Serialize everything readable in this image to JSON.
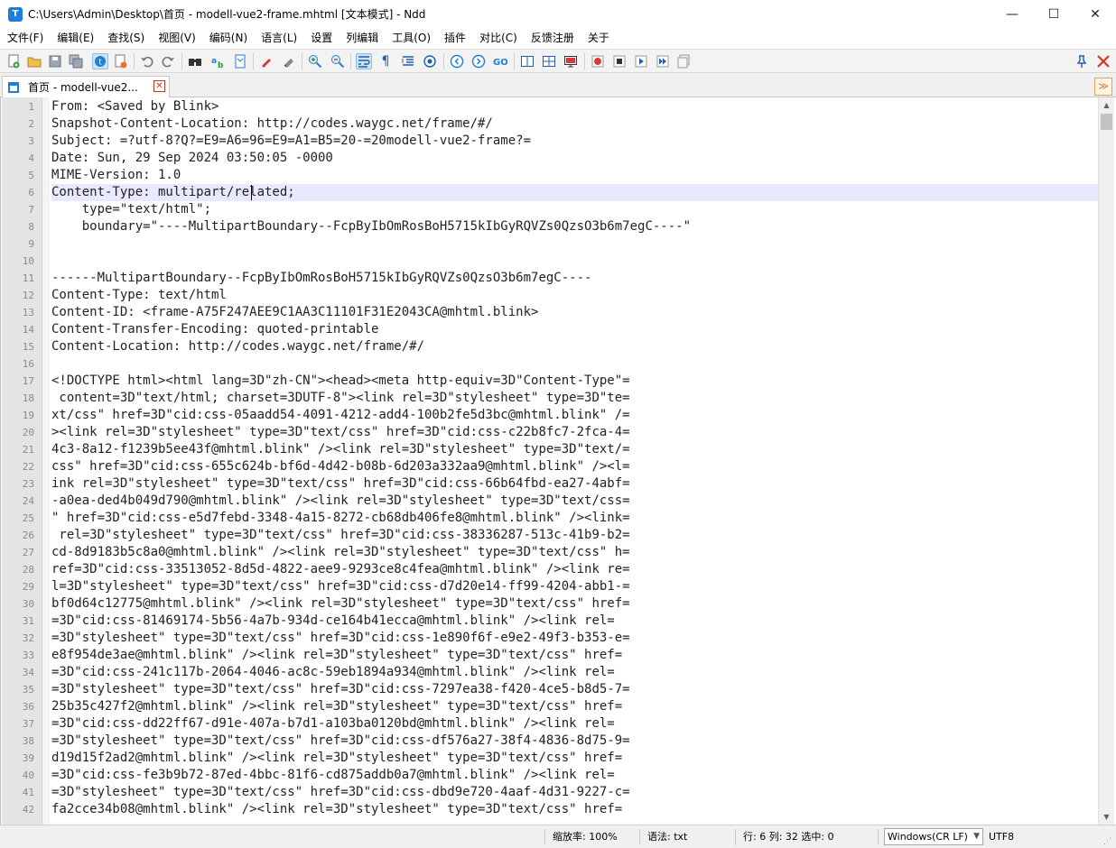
{
  "window": {
    "title": "C:\\Users\\Admin\\Desktop\\首页 - modell-vue2-frame.mhtml [文本模式] - Ndd",
    "app_icon_letter": "T",
    "minimize_glyph": "—",
    "maximize_glyph": "☐",
    "close_glyph": "✕"
  },
  "menu": [
    "文件(F)",
    "编辑(E)",
    "查找(S)",
    "视图(V)",
    "编码(N)",
    "语言(L)",
    "设置",
    "列编辑",
    "工具(O)",
    "插件",
    "对比(C)",
    "反馈注册",
    "关于"
  ],
  "toolbar": {
    "icons": [
      "new-file-icon",
      "open-file-icon",
      "save-icon",
      "save-all-icon",
      "text-mode-icon",
      "close-file-icon",
      "undo-icon",
      "redo-icon",
      "find-icon",
      "replace-icon",
      "bookmark-icon",
      "marker-icon",
      "eraser-icon",
      "zoom-in-icon",
      "zoom-out-icon",
      "word-wrap-icon",
      "show-symbols-icon",
      "indent-guide-icon",
      "target-icon",
      "prev-icon",
      "next-icon",
      "goto-icon",
      "split-horizontal-icon",
      "split-vertical-icon",
      "monitor-icon",
      "record-macro-icon",
      "stop-macro-icon",
      "play-macro-icon",
      "run-macro-multiple-icon",
      "save-macro-icon",
      "pin-icon",
      "close-red-icon"
    ]
  },
  "tabs": [
    {
      "label": "首页 - modell-vue2...",
      "close_glyph": "✕"
    }
  ],
  "tab_dropdown_glyph": "≫",
  "editor": {
    "current_line": 6,
    "caret_col": 32,
    "lines": [
      "From: <Saved by Blink>",
      "Snapshot-Content-Location: http://codes.waygc.net/frame/#/",
      "Subject: =?utf-8?Q?=E9=A6=96=E9=A1=B5=20-=20modell-vue2-frame?=",
      "Date: Sun, 29 Sep 2024 03:50:05 -0000",
      "MIME-Version: 1.0",
      "Content-Type: multipart/related;",
      "    type=\"text/html\";",
      "    boundary=\"----MultipartBoundary--FcpByIbOmRosBoH5715kIbGyRQVZs0QzsO3b6m7egC----\"",
      "",
      "",
      "------MultipartBoundary--FcpByIbOmRosBoH5715kIbGyRQVZs0QzsO3b6m7egC----",
      "Content-Type: text/html",
      "Content-ID: <frame-A75F247AEE9C1AA3C11101F31E2043CA@mhtml.blink>",
      "Content-Transfer-Encoding: quoted-printable",
      "Content-Location: http://codes.waygc.net/frame/#/",
      "",
      "<!DOCTYPE html><html lang=3D\"zh-CN\"><head><meta http-equiv=3D\"Content-Type\"=",
      " content=3D\"text/html; charset=3DUTF-8\"><link rel=3D\"stylesheet\" type=3D\"te=",
      "xt/css\" href=3D\"cid:css-05aadd54-4091-4212-add4-100b2fe5d3bc@mhtml.blink\" /=",
      "><link rel=3D\"stylesheet\" type=3D\"text/css\" href=3D\"cid:css-c22b8fc7-2fca-4=",
      "4c3-8a12-f1239b5ee43f@mhtml.blink\" /><link rel=3D\"stylesheet\" type=3D\"text/=",
      "css\" href=3D\"cid:css-655c624b-bf6d-4d42-b08b-6d203a332aa9@mhtml.blink\" /><l=",
      "ink rel=3D\"stylesheet\" type=3D\"text/css\" href=3D\"cid:css-66b64fbd-ea27-4abf=",
      "-a0ea-ded4b049d790@mhtml.blink\" /><link rel=3D\"stylesheet\" type=3D\"text/css=",
      "\" href=3D\"cid:css-e5d7febd-3348-4a15-8272-cb68db406fe8@mhtml.blink\" /><link=",
      " rel=3D\"stylesheet\" type=3D\"text/css\" href=3D\"cid:css-38336287-513c-41b9-b2=",
      "cd-8d9183b5c8a0@mhtml.blink\" /><link rel=3D\"stylesheet\" type=3D\"text/css\" h=",
      "ref=3D\"cid:css-33513052-8d5d-4822-aee9-9293ce8c4fea@mhtml.blink\" /><link re=",
      "l=3D\"stylesheet\" type=3D\"text/css\" href=3D\"cid:css-d7d20e14-ff99-4204-abb1-=",
      "bf0d64c12775@mhtml.blink\" /><link rel=3D\"stylesheet\" type=3D\"text/css\" href=",
      "=3D\"cid:css-81469174-5b56-4a7b-934d-ce164b41ecca@mhtml.blink\" /><link rel=",
      "=3D\"stylesheet\" type=3D\"text/css\" href=3D\"cid:css-1e890f6f-e9e2-49f3-b353-e=",
      "e8f954de3ae@mhtml.blink\" /><link rel=3D\"stylesheet\" type=3D\"text/css\" href=",
      "=3D\"cid:css-241c117b-2064-4046-ac8c-59eb1894a934@mhtml.blink\" /><link rel=",
      "=3D\"stylesheet\" type=3D\"text/css\" href=3D\"cid:css-7297ea38-f420-4ce5-b8d5-7=",
      "25b35c427f2@mhtml.blink\" /><link rel=3D\"stylesheet\" type=3D\"text/css\" href=",
      "=3D\"cid:css-dd22ff67-d91e-407a-b7d1-a103ba0120bd@mhtml.blink\" /><link rel=",
      "=3D\"stylesheet\" type=3D\"text/css\" href=3D\"cid:css-df576a27-38f4-4836-8d75-9=",
      "d19d15f2ad2@mhtml.blink\" /><link rel=3D\"stylesheet\" type=3D\"text/css\" href=",
      "=3D\"cid:css-fe3b9b72-87ed-4bbc-81f6-cd875addb0a7@mhtml.blink\" /><link rel=",
      "=3D\"stylesheet\" type=3D\"text/css\" href=3D\"cid:css-dbd9e720-4aaf-4d31-9227-c=",
      "fa2cce34b08@mhtml.blink\" /><link rel=3D\"stylesheet\" type=3D\"text/css\" href="
    ]
  },
  "status": {
    "zoom": "缩放率: 100%",
    "syntax": "语法: txt",
    "position": "行: 6 列: 32 选中: 0",
    "eol": "Windows(CR LF)",
    "encoding": "UTF8"
  },
  "scrollbar": {
    "up_glyph": "▲",
    "down_glyph": "▼"
  },
  "colors": {
    "current_line_highlight": "#e8e8ff",
    "gutter": "#e4e4e4",
    "toolbar_bg": "#f3f3f3",
    "close_red": "#e0302a",
    "accent_blue": "#1e7fd8"
  }
}
